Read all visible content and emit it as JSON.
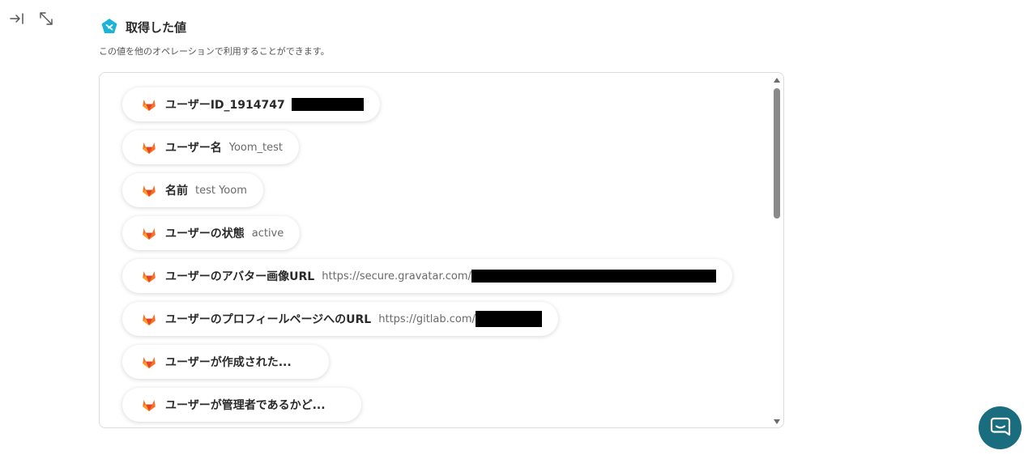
{
  "toolbar": {
    "collapse_icon": "collapse-right-icon",
    "expand_icon": "expand-diagonal-icon"
  },
  "header": {
    "title": "取得した値",
    "subtitle": "この値を他のオペレーションで利用することができます。",
    "logo_icon": "yoom-logo-icon"
  },
  "colors": {
    "accent": "#1ab4d8",
    "chat_button": "#1a6c7f",
    "gitlab_orange": "#e24329",
    "gitlab_light": "#fc6d26",
    "gitlab_yellow": "#fca326"
  },
  "values": [
    {
      "label": "ユーザーID_1914747",
      "value": "",
      "redacted": true
    },
    {
      "label": "ユーザー名",
      "value": "Yoom_test",
      "redacted": false
    },
    {
      "label": "名前",
      "value": "test Yoom",
      "redacted": false
    },
    {
      "label": "ユーザーの状態",
      "value": "active",
      "redacted": false
    },
    {
      "label": "ユーザーのアバター画像URL",
      "value": "https://secure.gravatar.com/",
      "redacted": true
    },
    {
      "label": "ユーザーのプロフィールページへのURL",
      "value": "https://gitlab.com/",
      "redacted": true
    },
    {
      "label": "ユーザーが作成された...",
      "value": "",
      "redacted": false
    },
    {
      "label": "ユーザーが管理者であるかど...",
      "value": "",
      "redacted": false
    }
  ],
  "chat": {
    "icon": "chat-bubble-icon"
  }
}
